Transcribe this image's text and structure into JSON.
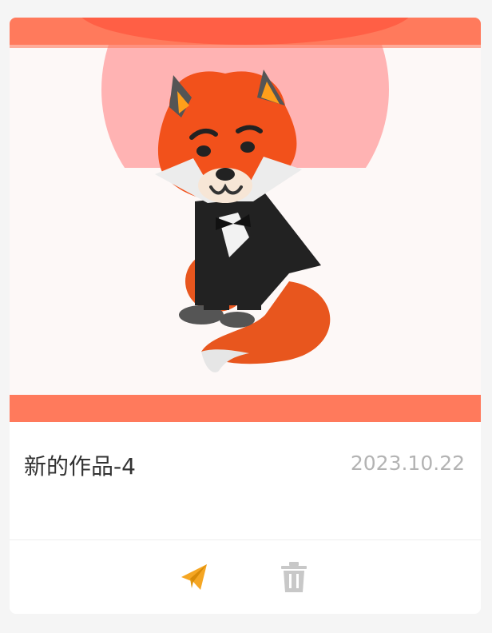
{
  "work": {
    "title": "新的作品-4",
    "date": "2023.10.22"
  },
  "actions": {
    "share_icon": "paper-plane-icon",
    "delete_icon": "trash-icon"
  },
  "colors": {
    "banner": "#ff7a5c",
    "share": "#f5a623",
    "delete": "#c8c8c8"
  }
}
